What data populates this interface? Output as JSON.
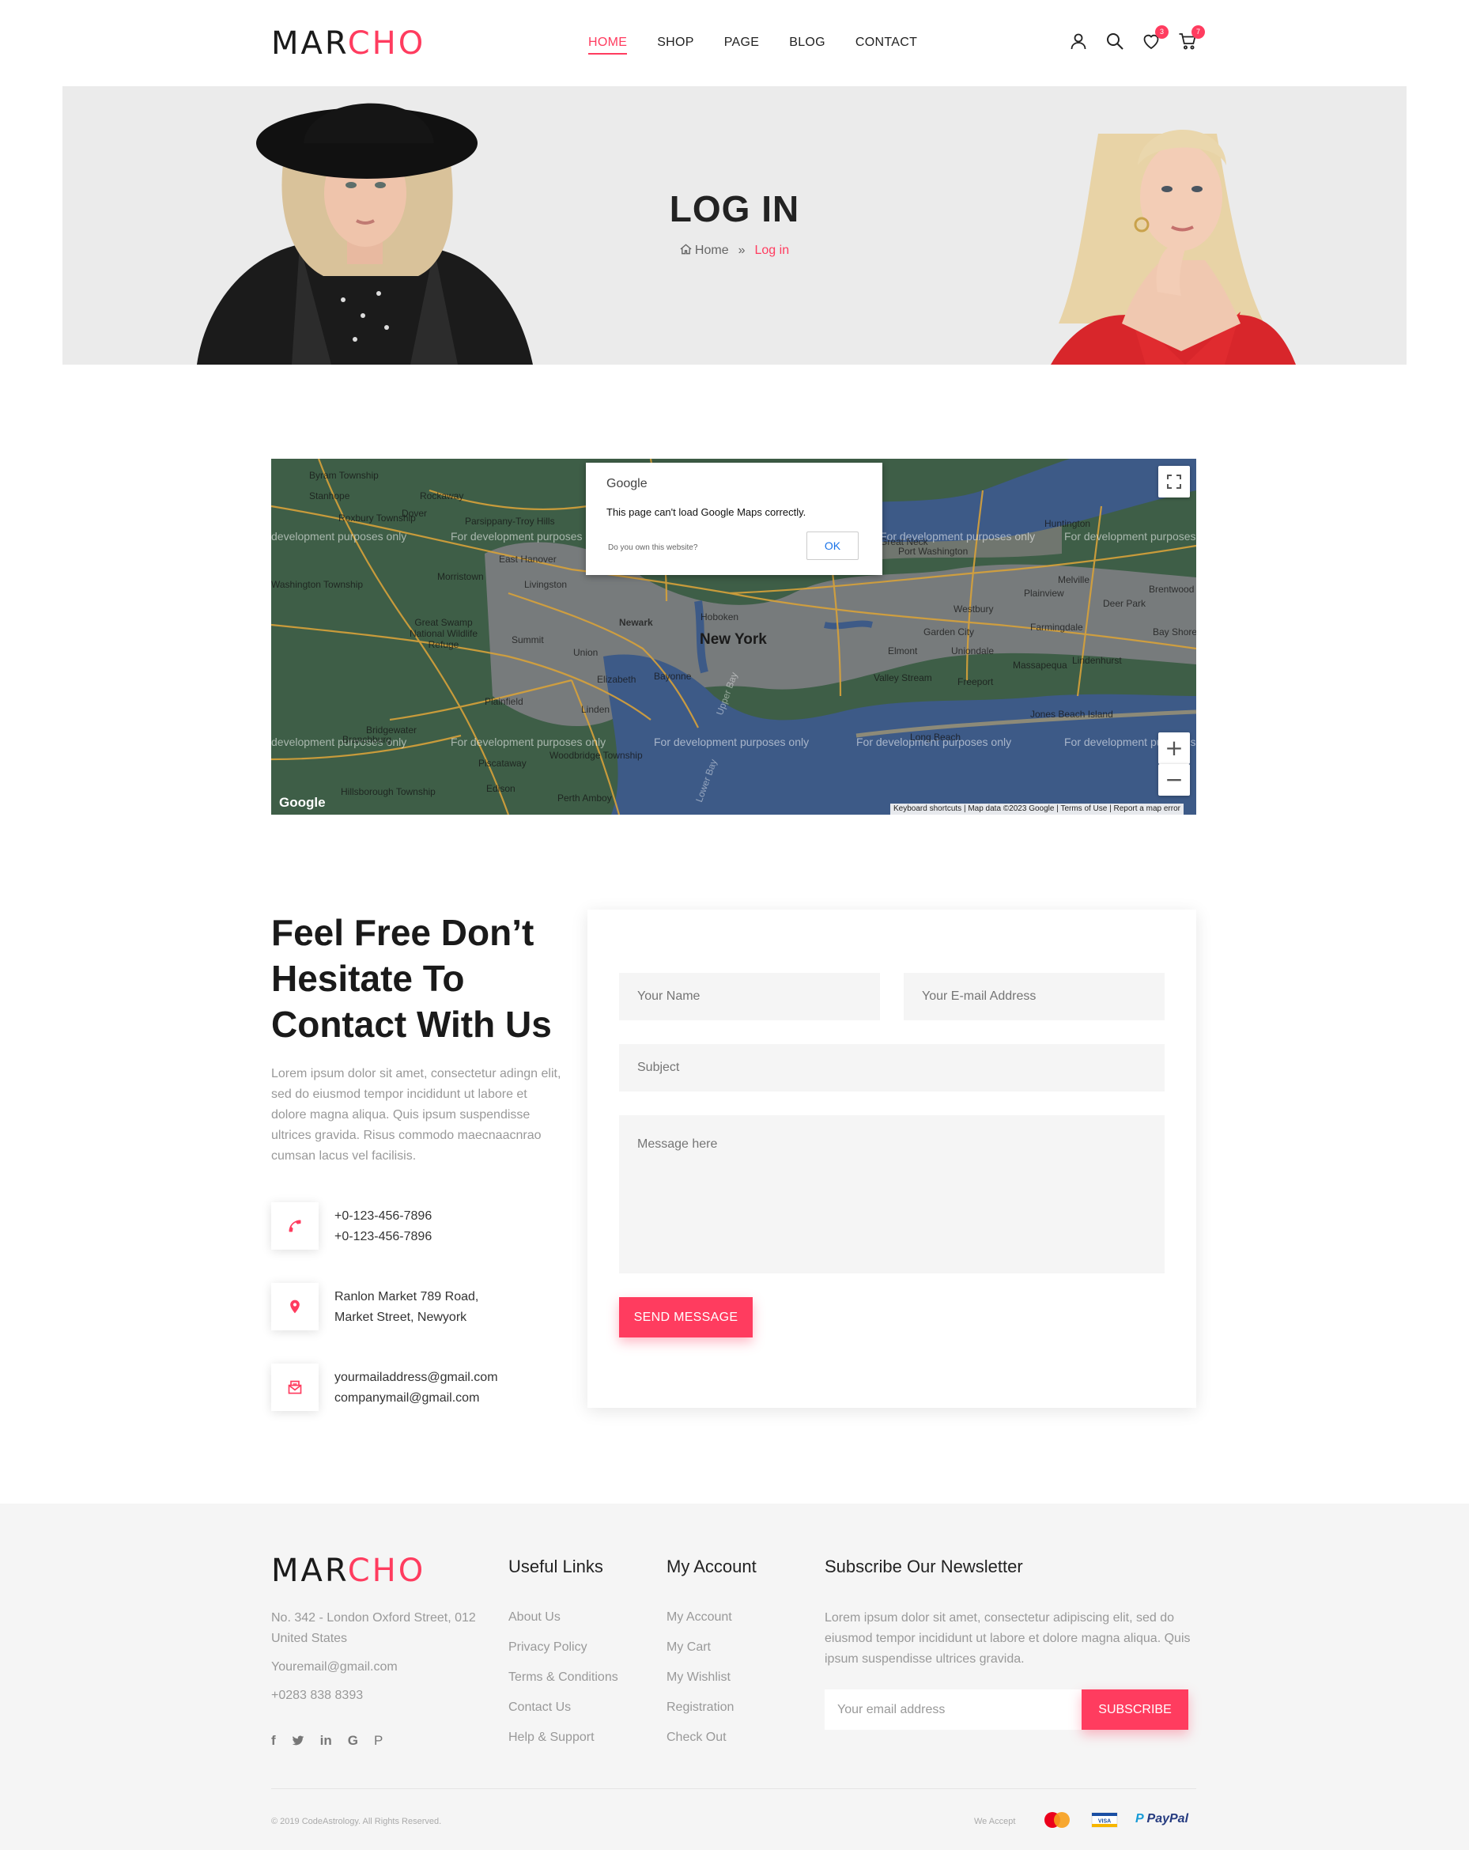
{
  "brand": {
    "part1": "MAR",
    "part2": "CHO",
    "accent": "#ff3c5f"
  },
  "nav": [
    {
      "label": "HOME",
      "active": true
    },
    {
      "label": "SHOP"
    },
    {
      "label": "PAGE"
    },
    {
      "label": "BLOG"
    },
    {
      "label": "CONTACT"
    }
  ],
  "header_icons": {
    "user": "user-icon",
    "search": "search-icon",
    "wishlist": "heart-icon",
    "wishlist_count": "3",
    "cart": "cart-icon",
    "cart_count": "7"
  },
  "banner": {
    "title": "LOG IN",
    "breadcrumb": {
      "home": "Home",
      "separator": "»",
      "current": "Log in"
    }
  },
  "map": {
    "watermark": "For development purposes only",
    "watermark_cut_left": "development purposes only",
    "dialog": {
      "brand": "Google",
      "message": "This page can't load Google Maps correctly.",
      "own_site": "Do you own this website?",
      "ok": "OK"
    },
    "places": [
      "Byram Township",
      "Stanhope",
      "Rockaway",
      "Dover",
      "Roxbury Township",
      "Parsippany-Troy Hills",
      "East Hanover",
      "Morristown",
      "Livingston",
      "Washington Township",
      "Great Swamp National Wildlife Refuge",
      "Summit",
      "Newark",
      "Hoboken",
      "New York",
      "Union",
      "Elizabeth",
      "Bayonne",
      "Plainfield",
      "Linden",
      "Bridgewater",
      "Branchburg",
      "Piscataway",
      "Woodbridge Township",
      "Edison",
      "Perth Amboy",
      "Hillsborough Township",
      "Port Washington",
      "Great Neck",
      "Huntington",
      "Melville",
      "Plainview",
      "Westbury",
      "Garden City",
      "Farmingdale",
      "Elmont",
      "Uniondale",
      "Valley Stream",
      "Freeport",
      "Massapequa",
      "Lindenhurst",
      "Long Beach",
      "Jones Beach Island",
      "Deer Park",
      "Brentwood",
      "Bay Shore",
      "Upper Bay",
      "Lower Bay"
    ],
    "google_logo": "Google",
    "footer": [
      "Keyboard shortcuts",
      "Map data ©2023 Google",
      "Terms of Use",
      "Report a map error"
    ],
    "zoom_in": "+",
    "zoom_out": "−"
  },
  "contact": {
    "title": "Feel Free Don’t Hesitate To Contact With Us",
    "text": "Lorem ipsum dolor sit amet, consectetur adingn elit, sed do eiusmod tempor incididunt ut labore et dolore magna aliqua. Quis ipsum suspendisse ultrices gravida. Risus commodo maecnaacnrao cumsan lacus vel facilisis.",
    "phone": [
      "+0-123-456-7896",
      "+0-123-456-7896"
    ],
    "address": [
      "Ranlon Market 789 Road,",
      "Market Street, Newyork"
    ],
    "email": [
      "yourmailaddress@gmail.com",
      "companymail@gmail.com"
    ]
  },
  "form": {
    "name_placeholder": "Your Name",
    "email_placeholder": "Your E-mail Address",
    "subject_placeholder": "Subject",
    "message_placeholder": "Message here",
    "send_label": "SEND MESSAGE"
  },
  "footer": {
    "address": "No. 342 - London Oxford Street, 012 United States",
    "email": "Youremail@gmail.com",
    "phone": "+0283 838 8393",
    "social": [
      "f",
      "t",
      "in",
      "G",
      "P"
    ],
    "useful_links": {
      "title": "Useful Links",
      "items": [
        "About Us",
        "Privacy Policy",
        "Terms & Conditions",
        "Contact Us",
        "Help & Support"
      ]
    },
    "my_account": {
      "title": "My Account",
      "items": [
        "My Account",
        "My Cart",
        "My Wishlist",
        "Registration",
        "Check Out"
      ]
    },
    "newsletter": {
      "title": "Subscribe Our Newsletter",
      "text": "Lorem ipsum dolor sit amet, consectetur adipiscing elit, sed do eiusmod tempor incididunt ut labore et dolore magna aliqua. Quis ipsum suspendisse ultrices gravida.",
      "placeholder": "Your email address",
      "button": "SUBSCRIBE"
    },
    "copyright": "© 2019 CodeAstrology. All Rights Reserved.",
    "we_accept": "We Accept",
    "payments": [
      "MasterCard",
      "VISA",
      "PayPal"
    ]
  }
}
